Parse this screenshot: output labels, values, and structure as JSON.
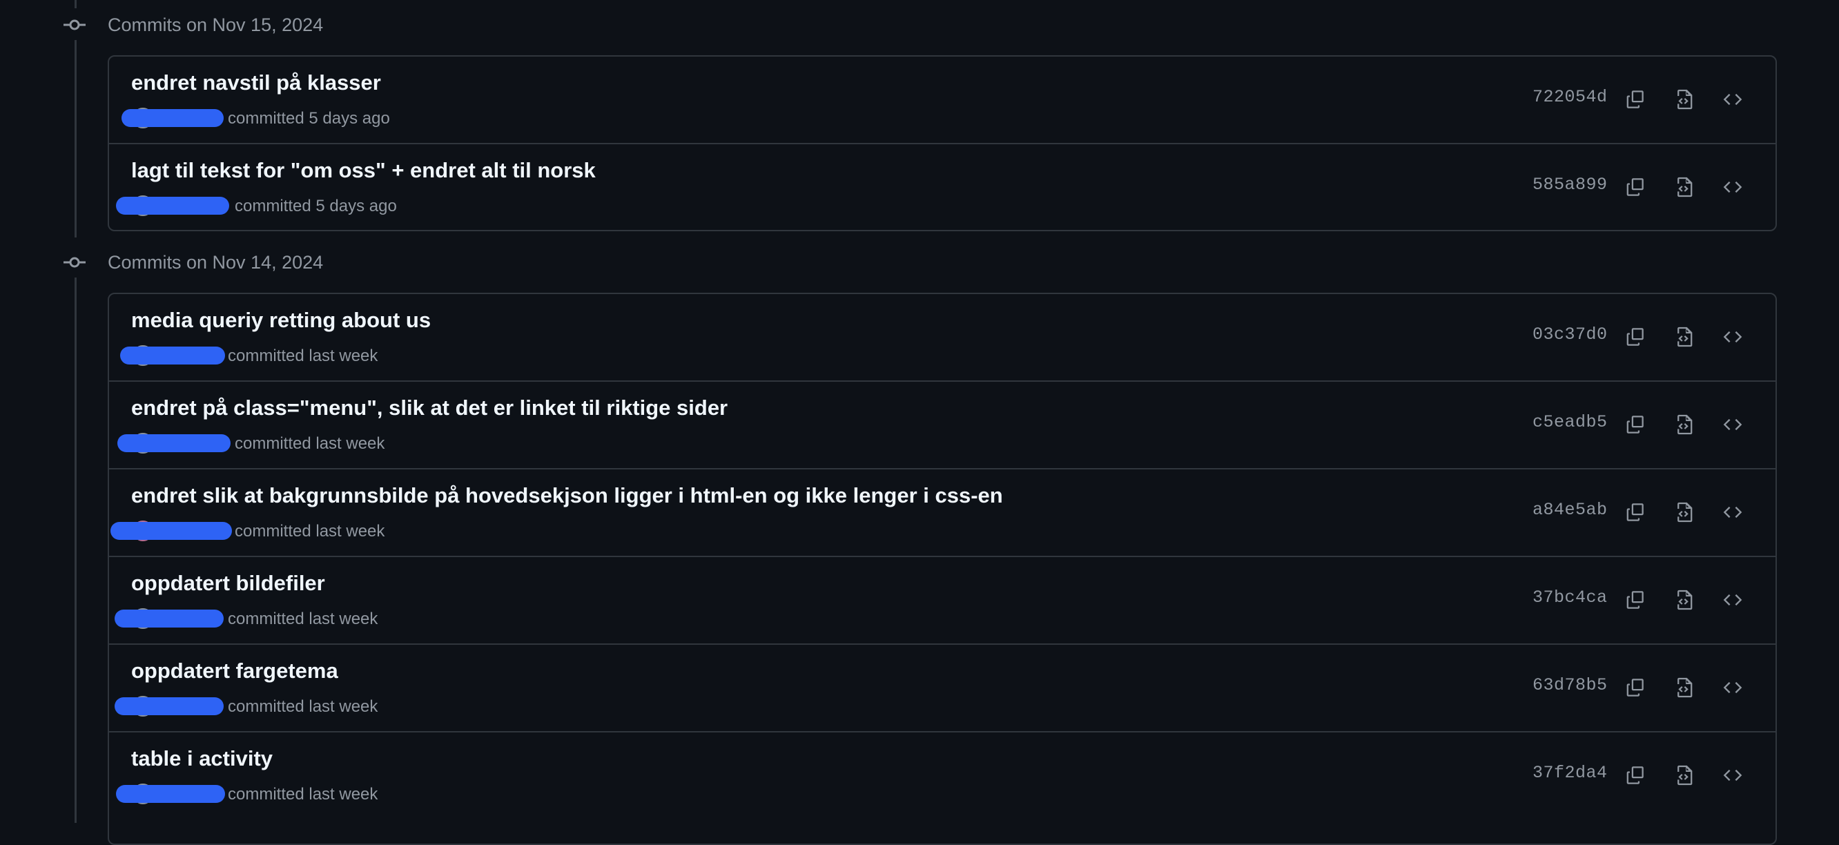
{
  "icons": {
    "commit_node": "git-commit-icon",
    "copy": "copy-icon",
    "file_code": "file-code-icon",
    "code": "code-icon"
  },
  "colors": {
    "background": "#0d1117",
    "border": "#30363d",
    "muted_text": "#9198a1",
    "primary_text": "#f0f6fc",
    "redaction": "#2e63f5"
  },
  "groups": [
    {
      "title": "Commits on Nov 15, 2024",
      "commits": [
        {
          "title": "endret navstil på klasser",
          "meta": "committed 5 days ago",
          "sha": "722054d"
        },
        {
          "title": "lagt til tekst for \"om oss\" + endret alt til norsk",
          "meta": "committed 5 days ago",
          "sha": "585a899"
        }
      ]
    },
    {
      "title": "Commits on Nov 14, 2024",
      "commits": [
        {
          "title": "media queriy retting about us",
          "meta": "committed last week",
          "sha": "03c37d0"
        },
        {
          "title": "endret på class=\"menu\", slik at det er linket til riktige sider",
          "meta": "committed last week",
          "sha": "c5eadb5"
        },
        {
          "title": "endret slik at bakgrunnsbilde på hovedsekjson ligger i html-en og ikke lenger i css-en",
          "meta": "committed last week",
          "sha": "a84e5ab"
        },
        {
          "title": "oppdatert bildefiler",
          "meta": "committed last week",
          "sha": "37bc4ca"
        },
        {
          "title": "oppdatert fargetema",
          "meta": "committed last week",
          "sha": "63d78b5"
        },
        {
          "title": "table i activity",
          "meta": "committed last week",
          "sha": "37f2da4"
        }
      ]
    }
  ]
}
